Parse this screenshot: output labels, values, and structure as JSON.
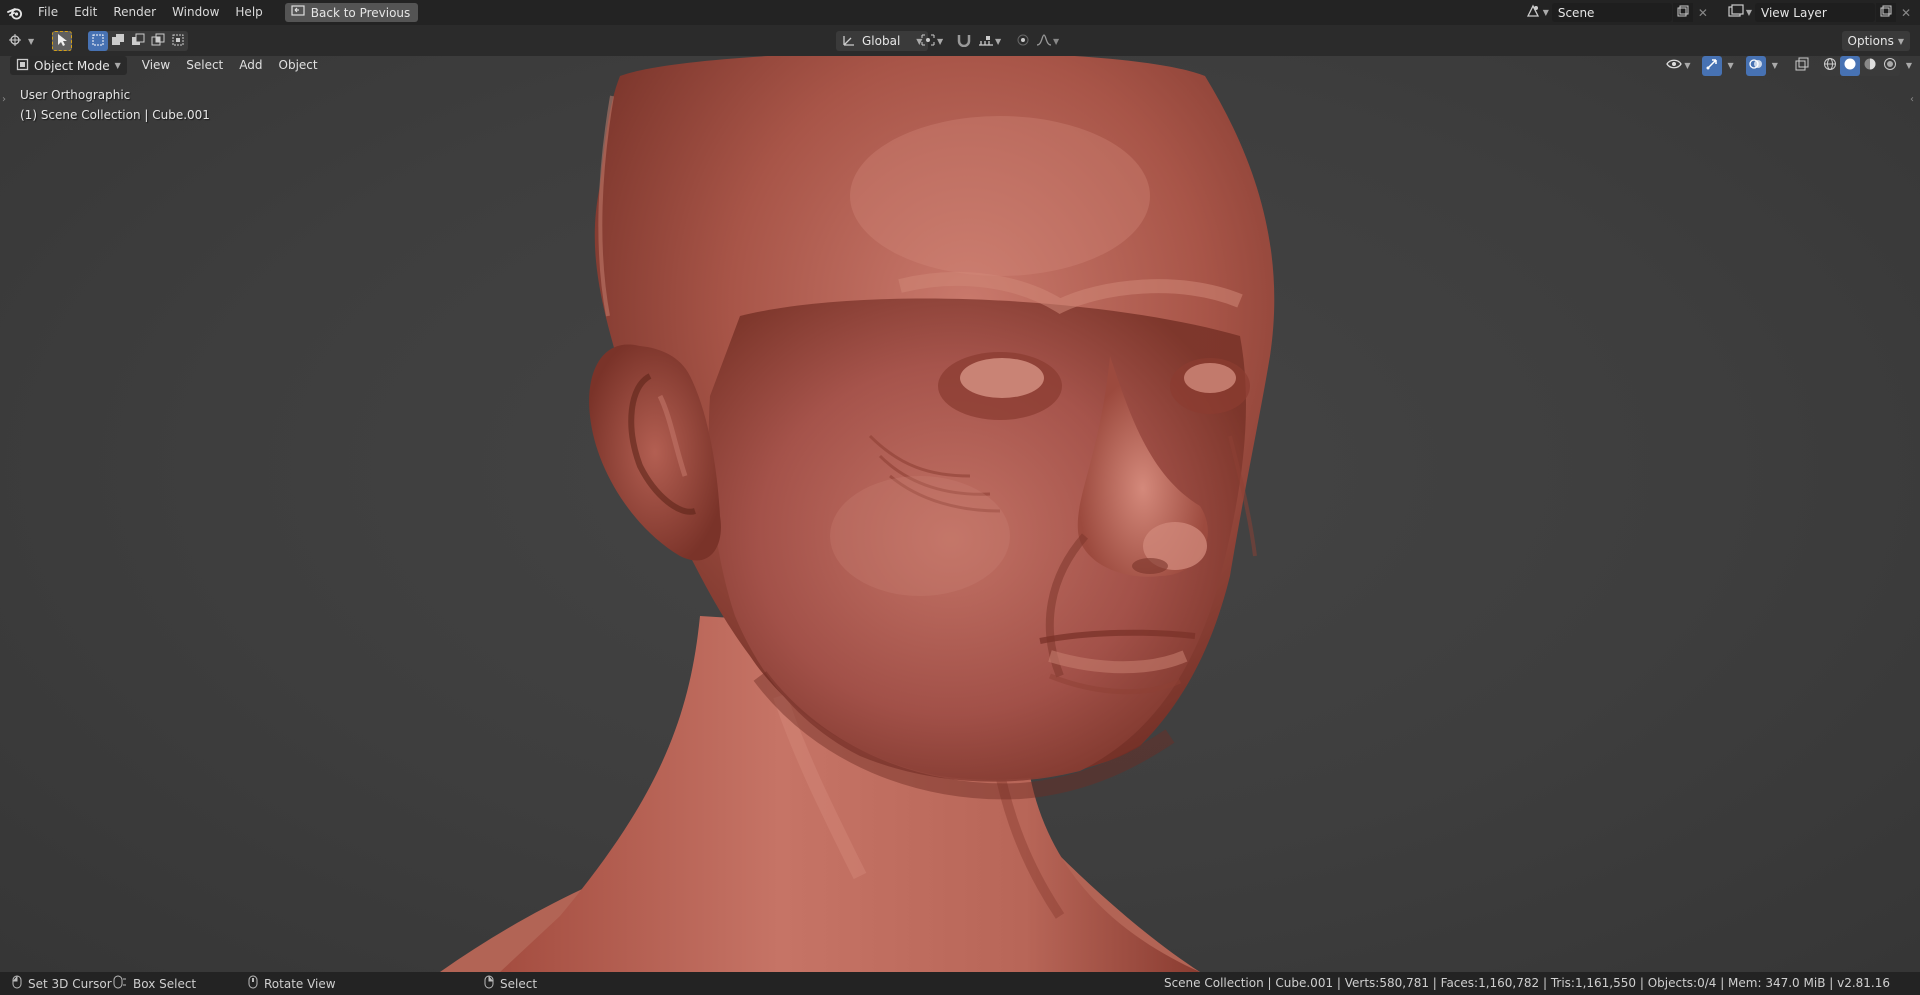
{
  "topbar": {
    "menu": [
      "File",
      "Edit",
      "Render",
      "Window",
      "Help"
    ],
    "back_button": "Back to Previous",
    "scene_name": "Scene",
    "view_layer_name": "View Layer"
  },
  "toolheader": {
    "orientation": "Global",
    "options_label": "Options"
  },
  "viewport": {
    "mode": "Object Mode",
    "menu": [
      "View",
      "Select",
      "Add",
      "Object"
    ],
    "view_name": "User Orthographic",
    "collection_info": "(1) Scene Collection | Cube.001",
    "model_color": "#b45a4b",
    "background_color": "#3d3d3d"
  },
  "statusbar": {
    "left_mouse": "Set 3D Cursor",
    "box_select": "Box Select",
    "rotate_view": "Rotate View",
    "select": "Select",
    "stats": "Scene Collection | Cube.001 | Verts:580,781 | Faces:1,160,782 | Tris:1,161,550 | Objects:0/4 | Mem: 347.0 MiB | v2.81.16"
  },
  "colors": {
    "header_bg": "#232323",
    "accent_blue": "#4772b3",
    "skin_light": "#c8786a",
    "skin_dark": "#7a3026"
  }
}
